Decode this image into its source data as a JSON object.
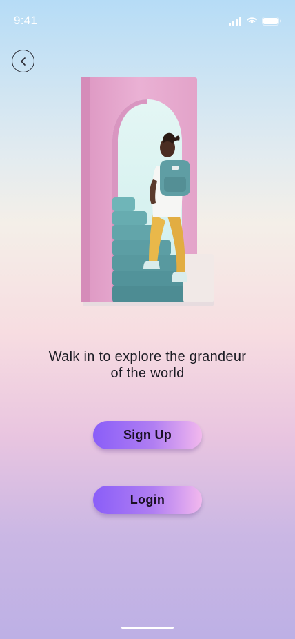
{
  "status_bar": {
    "time": "9:41",
    "icons": [
      "cellular-signal-icon",
      "wifi-icon",
      "battery-icon"
    ]
  },
  "nav": {
    "back_icon": "chevron-left-icon"
  },
  "hero": {
    "illustration": "person-walking-through-arch-illustration"
  },
  "content": {
    "tagline_line1": "Walk in to explore the grandeur",
    "tagline_line2": "of the world"
  },
  "actions": {
    "signup_label": "Sign Up",
    "login_label": "Login"
  },
  "colors": {
    "button_gradient_start": "#8a5ef8",
    "button_gradient_end": "#f2b8ee",
    "arch_pink": "#e7a9cf",
    "stairs_teal": "#5c9ea4"
  }
}
